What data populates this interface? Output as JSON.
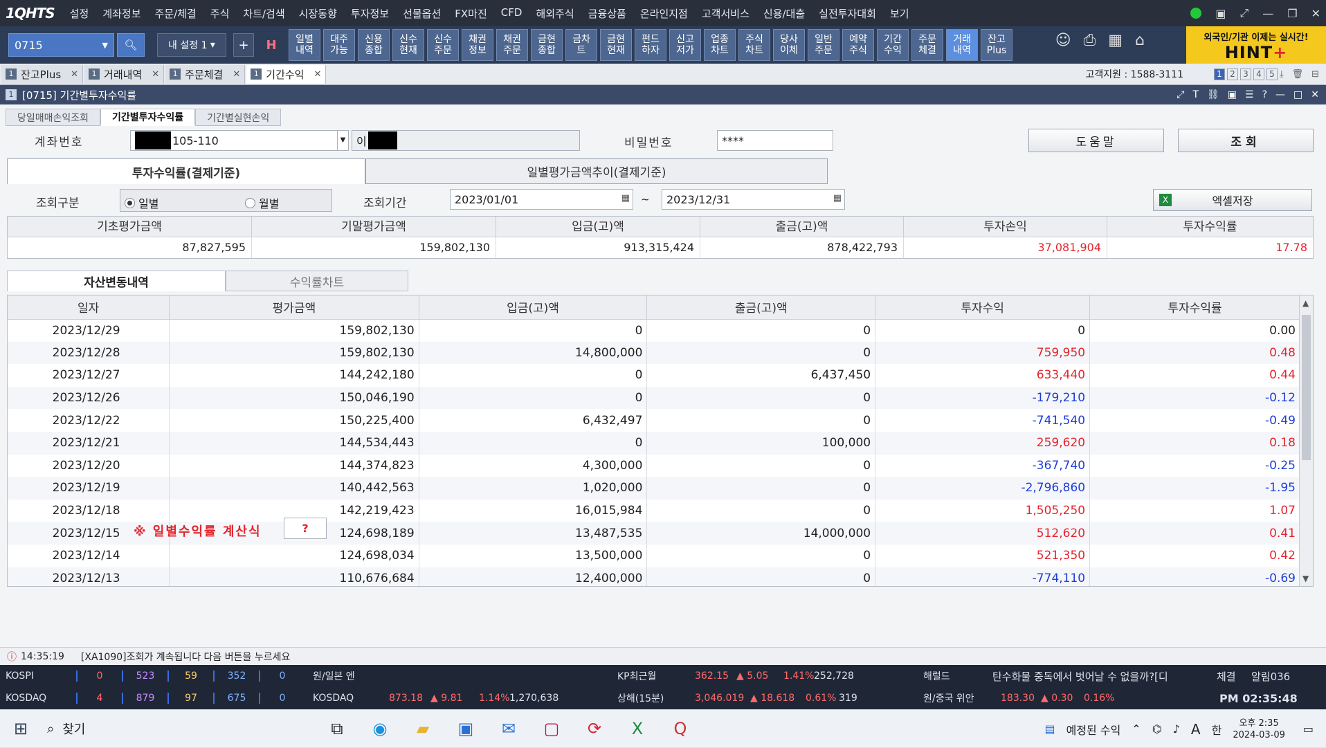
{
  "menubar": {
    "logo_a": "1Q",
    "logo_b": "HTS",
    "items": [
      "설정",
      "계좌정보",
      "주문/체결",
      "주식",
      "차트/검색",
      "시장동향",
      "투자정보",
      "선물옵션",
      "FX마진",
      "CFD",
      "해외주식",
      "금융상품",
      "온라인지점",
      "고객서비스",
      "신용/대출",
      "실전투자대회",
      "보기"
    ]
  },
  "toolbar": {
    "account": "0715",
    "myset": "내 설정 1",
    "quick": [
      "일별\n내역",
      "대주\n가능",
      "신용\n종합",
      "신수\n현재",
      "신수\n주문",
      "채권\n정보",
      "채권\n주문",
      "금현\n종합",
      "금차\n트",
      "금현\n현재",
      "펀드\n하자",
      "신고\n저가",
      "업종\n차트",
      "주식\n차트",
      "당사\n이체",
      "일반\n주문",
      "예약\n주식",
      "기간\n수익",
      "주문\n체결",
      "거래\n내역",
      "잔고\nPlus"
    ],
    "hint_line1": "외국인/기관 이제는 실시간!",
    "hint_line2": "HINT",
    "hint_plus": "+"
  },
  "tabs": [
    {
      "label": "잔고Plus"
    },
    {
      "label": "거래내역"
    },
    {
      "label": "주문체결"
    },
    {
      "label": "기간수익"
    }
  ],
  "support": "고객지원 : 1588-3111",
  "pages": [
    "1",
    "2",
    "3",
    "4",
    "5"
  ],
  "window": {
    "title": "[0715] 기간별투자수익률",
    "subtabs": [
      "당일매매손익조회",
      "기간별투자수익률",
      "기간별실현손익"
    ]
  },
  "form": {
    "account_label": "계좌번호",
    "account_value": "105-110",
    "name_prefix": "이",
    "pw_label": "비밀번호",
    "pw_value": "****",
    "help_btn": "도움말",
    "query_btn": "조회",
    "tab1": "투자수익률(결제기준)",
    "tab2": "일별평가금액추이(결제기준)",
    "type_label": "조회구분",
    "opt_daily": "일별",
    "opt_monthly": "월별",
    "period_label": "조회기간",
    "date_from": "2023/01/01",
    "tilde": "~",
    "date_to": "2023/12/31",
    "excel_btn": "엑셀저장"
  },
  "summary": {
    "headers": [
      "기초평가금액",
      "기말평가금액",
      "입금(고)액",
      "출금(고)액",
      "투자손익",
      "투자수익률"
    ],
    "values": [
      "87,827,595",
      "159,802,130",
      "913,315,424",
      "878,422,793",
      "37,081,904",
      "17.78"
    ]
  },
  "asset_tabs": [
    "자산변동내역",
    "수익률차트"
  ],
  "grid": {
    "headers": [
      "일자",
      "평가금액",
      "입금(고)액",
      "출금(고)액",
      "투자수익",
      "투자수익률"
    ],
    "rows": [
      [
        "2023/12/29",
        "159,802,130",
        "0",
        "0",
        "0",
        "0.00"
      ],
      [
        "2023/12/28",
        "159,802,130",
        "14,800,000",
        "0",
        "759,950",
        "0.48"
      ],
      [
        "2023/12/27",
        "144,242,180",
        "0",
        "6,437,450",
        "633,440",
        "0.44"
      ],
      [
        "2023/12/26",
        "150,046,190",
        "0",
        "0",
        "-179,210",
        "-0.12"
      ],
      [
        "2023/12/22",
        "150,225,400",
        "6,432,497",
        "0",
        "-741,540",
        "-0.49"
      ],
      [
        "2023/12/21",
        "144,534,443",
        "0",
        "100,000",
        "259,620",
        "0.18"
      ],
      [
        "2023/12/20",
        "144,374,823",
        "4,300,000",
        "0",
        "-367,740",
        "-0.25"
      ],
      [
        "2023/12/19",
        "140,442,563",
        "1,020,000",
        "0",
        "-2,796,860",
        "-1.95"
      ],
      [
        "2023/12/18",
        "142,219,423",
        "16,015,984",
        "0",
        "1,505,250",
        "1.07"
      ],
      [
        "2023/12/15",
        "124,698,189",
        "13,487,535",
        "14,000,000",
        "512,620",
        "0.41"
      ],
      [
        "2023/12/14",
        "124,698,034",
        "13,500,000",
        "0",
        "521,350",
        "0.42"
      ],
      [
        "2023/12/13",
        "110,676,684",
        "12,400,000",
        "0",
        "-774,110",
        "-0.69"
      ]
    ]
  },
  "formula": "※ 일별수익률 계산식",
  "formula_btn": "?",
  "status": {
    "time": "14:35:19",
    "msg": "[XA1090]조회가 계속됩니다 다음 버튼을 누르세요"
  },
  "ticker": {
    "row1": {
      "label": "KOSPI",
      "cells": [
        "0",
        "523",
        "59",
        "352",
        "0"
      ],
      "fx_label": "원/일본 엔",
      "kp_label": "KP최근월",
      "kp_price": "362.15",
      "kp_chg": "▲ 5.05",
      "kp_pct": "1.41%",
      "kp_vol": "252,728",
      "news_label": "해럴드",
      "news": "탄수화물 중독에서 벗어날 수 없을까?[디",
      "fill_btn": "체결",
      "alarm": "알림036"
    },
    "row2": {
      "label": "KOSDAQ",
      "cells": [
        "4",
        "879",
        "97",
        "675",
        "0"
      ],
      "idx_label": "KOSDAQ",
      "idx_price": "873.18",
      "idx_chg": "▲ 9.81",
      "idx_pct": "1.14%",
      "idx_vol": "1,270,638",
      "sh_label": "상해(15분)",
      "sh_price": "3,046.019",
      "sh_chg": "▲ 18.618",
      "sh_pct": "0.61%",
      "sh_vol": "319",
      "cny_label": "원/중국 위안",
      "cny_price": "183.30",
      "cny_chg": "▲ 0.30",
      "cny_pct": "0.16%",
      "clock": "PM 02:35:48"
    }
  },
  "taskbar": {
    "search": "찾기",
    "scheduled": "예정된 수익",
    "lang": "A",
    "ime": "한",
    "time": "오후 2:35",
    "date": "2024-03-09"
  }
}
